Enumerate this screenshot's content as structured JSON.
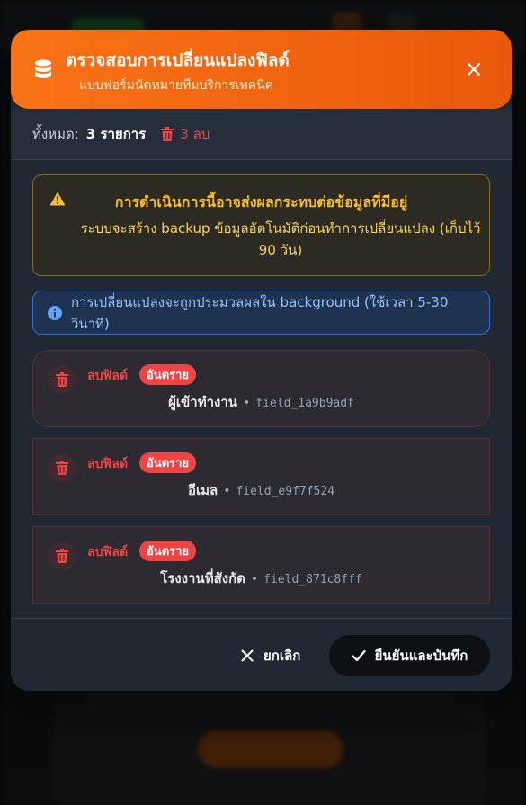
{
  "modal": {
    "title": "ตรวจสอบการเปลี่ยนแปลงฟิลด์",
    "subtitle": "แบบฟอร์มนัดหมายทีมบริการเทคนิค",
    "header_icon": "database-icon",
    "close_icon": "close-icon"
  },
  "summary": {
    "total_label": "ทั้งหมด:",
    "total_value": "3 รายการ",
    "delete_count": "3 ลบ"
  },
  "warning": {
    "title": "การดำเนินการนี้อาจส่งผลกระทบต่อข้อมูลที่มีอยู่",
    "text": "ระบบจะสร้าง backup ข้อมูลอัตโนมัติก่อนทำการเปลี่ยนแปลง (เก็บไว้ 90 วัน)"
  },
  "info": {
    "text": "การเปลี่ยนแปลงจะถูกประมวลผลใน background (ใช้เวลา 5-30 วินาที)"
  },
  "changes": [
    {
      "action": "ลบฟิลด์",
      "badge": "อันตราย",
      "field_name": "ผู้เข้าทำงาน",
      "field_key": "field_1a9b9adf"
    },
    {
      "action": "ลบฟิลด์",
      "badge": "อันตราย",
      "field_name": "อีเมล",
      "field_key": "field_e9f7f524"
    },
    {
      "action": "ลบฟิลด์",
      "badge": "อันตราย",
      "field_name": "โรงงานที่สังกัด",
      "field_key": "field_871c8fff"
    }
  ],
  "footer": {
    "cancel_label": "ยกเลิก",
    "confirm_label": "ยืนยันและบันทึก"
  },
  "colors": {
    "accent": "#f97316",
    "danger": "#ef4444",
    "warning": "#fbbf24",
    "info": "#93c5fd"
  }
}
